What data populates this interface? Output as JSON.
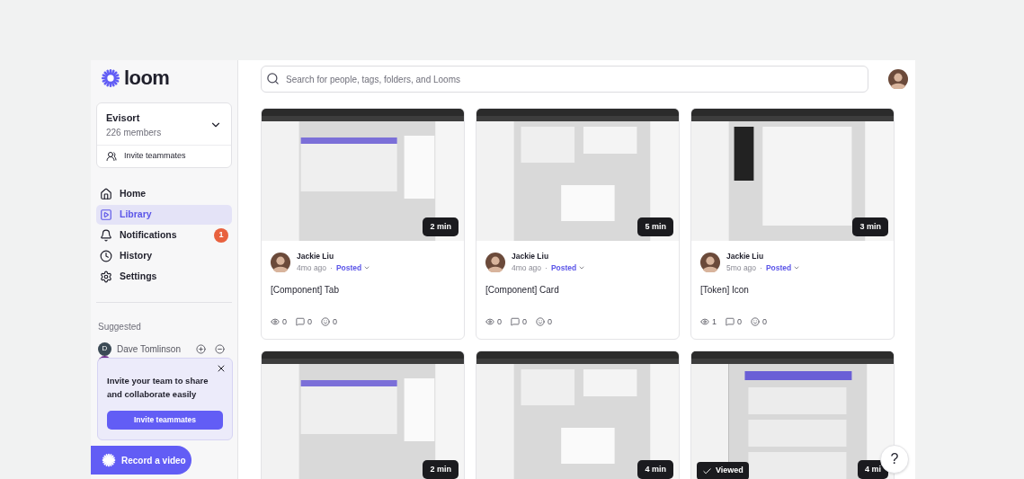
{
  "sidebar": {
    "logo": "loom",
    "workspace": {
      "name": "Evisort",
      "members": "226 members"
    },
    "invite_link": "Invite teammates",
    "nav": [
      {
        "kind": "home",
        "label": "Home",
        "selected": false
      },
      {
        "kind": "library",
        "label": "Library",
        "selected": true
      },
      {
        "kind": "bell",
        "label": "Notifications",
        "selected": false,
        "badge": "1"
      },
      {
        "kind": "clock",
        "label": "History",
        "selected": false
      },
      {
        "kind": "gear",
        "label": "Settings",
        "selected": false
      }
    ],
    "suggested_title": "Suggested",
    "suggested": [
      {
        "initial": "D",
        "name": "Dave Tomlinson"
      }
    ],
    "invite_popup": {
      "text": "Invite your team to share and collaborate easily",
      "button": "Invite teammates"
    },
    "record_button": "Record a video"
  },
  "search": {
    "placeholder": "Search for people, tags, folders, and Looms"
  },
  "videos": [
    {
      "duration": "2 min",
      "viewed": false,
      "author": "Jackie Liu",
      "age": "4mo ago",
      "separator": "·",
      "status": "Posted",
      "title": "[Component] Tab",
      "views": "0",
      "comments": "0",
      "reactions": "0"
    },
    {
      "duration": "5 min",
      "viewed": false,
      "author": "Jackie Liu",
      "age": "4mo ago",
      "separator": "·",
      "status": "Posted",
      "title": "[Component] Card",
      "views": "0",
      "comments": "0",
      "reactions": "0"
    },
    {
      "duration": "3 min",
      "viewed": false,
      "author": "Jackie Liu",
      "age": "5mo ago",
      "separator": "·",
      "status": "Posted",
      "title": "[Token] Icon",
      "views": "1",
      "comments": "0",
      "reactions": "0"
    },
    {
      "duration": "2 min",
      "viewed": false
    },
    {
      "duration": "4 min",
      "viewed": false
    },
    {
      "duration": "4 mi",
      "viewed": true,
      "viewed_label": "Viewed"
    }
  ],
  "help_button": "?"
}
